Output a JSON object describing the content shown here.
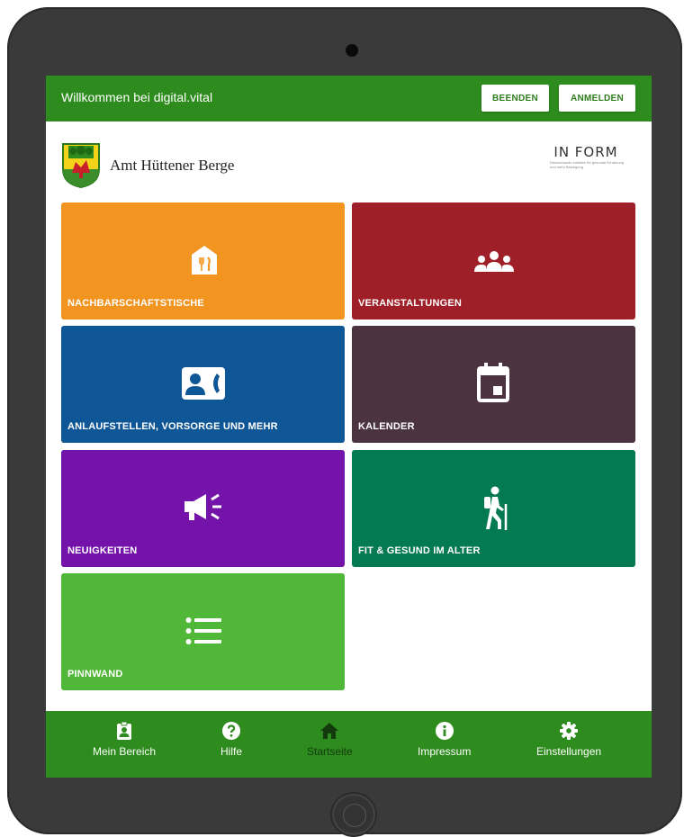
{
  "header": {
    "title": "Willkommen bei digital.vital",
    "beenden_label": "BEENDEN",
    "anmelden_label": "ANMELDEN",
    "color": "#2e8b1e"
  },
  "brand": {
    "name": "Amt Hüttener Berge",
    "partner_logo": "IN FORM",
    "partner_tagline_1": "Deutschlands Initiative für gesunde Ernährung",
    "partner_tagline_2": "und mehr Bewegung"
  },
  "tiles": [
    {
      "label": "NACHBARSCHAFTSTISCHE",
      "color": "#f29420",
      "icon": "restaurant-house-icon"
    },
    {
      "label": "VERANSTALTUNGEN",
      "color": "#9e1f27",
      "icon": "group-icon"
    },
    {
      "label": "ANLAUFSTELLEN, VORSORGE UND MEHR",
      "color": "#0f5696",
      "icon": "contact-phone-icon"
    },
    {
      "label": "KALENDER",
      "color": "#4c3340",
      "icon": "calendar-icon"
    },
    {
      "label": "NEUIGKEITEN",
      "color": "#7413a9",
      "icon": "megaphone-icon"
    },
    {
      "label": "FIT & GESUND IM ALTER",
      "color": "#047a52",
      "icon": "hiker-icon"
    },
    {
      "label": "PINNWAND",
      "color": "#51b738",
      "icon": "list-icon"
    }
  ],
  "bottom_nav": [
    {
      "label": "Mein Bereich",
      "icon": "clipboard-user-icon",
      "active": false
    },
    {
      "label": "Hilfe",
      "icon": "help-icon",
      "active": false
    },
    {
      "label": "Startseite",
      "icon": "home-icon",
      "active": true
    },
    {
      "label": "Impressum",
      "icon": "info-icon",
      "active": false
    },
    {
      "label": "Einstellungen",
      "icon": "gear-icon",
      "active": false
    }
  ]
}
